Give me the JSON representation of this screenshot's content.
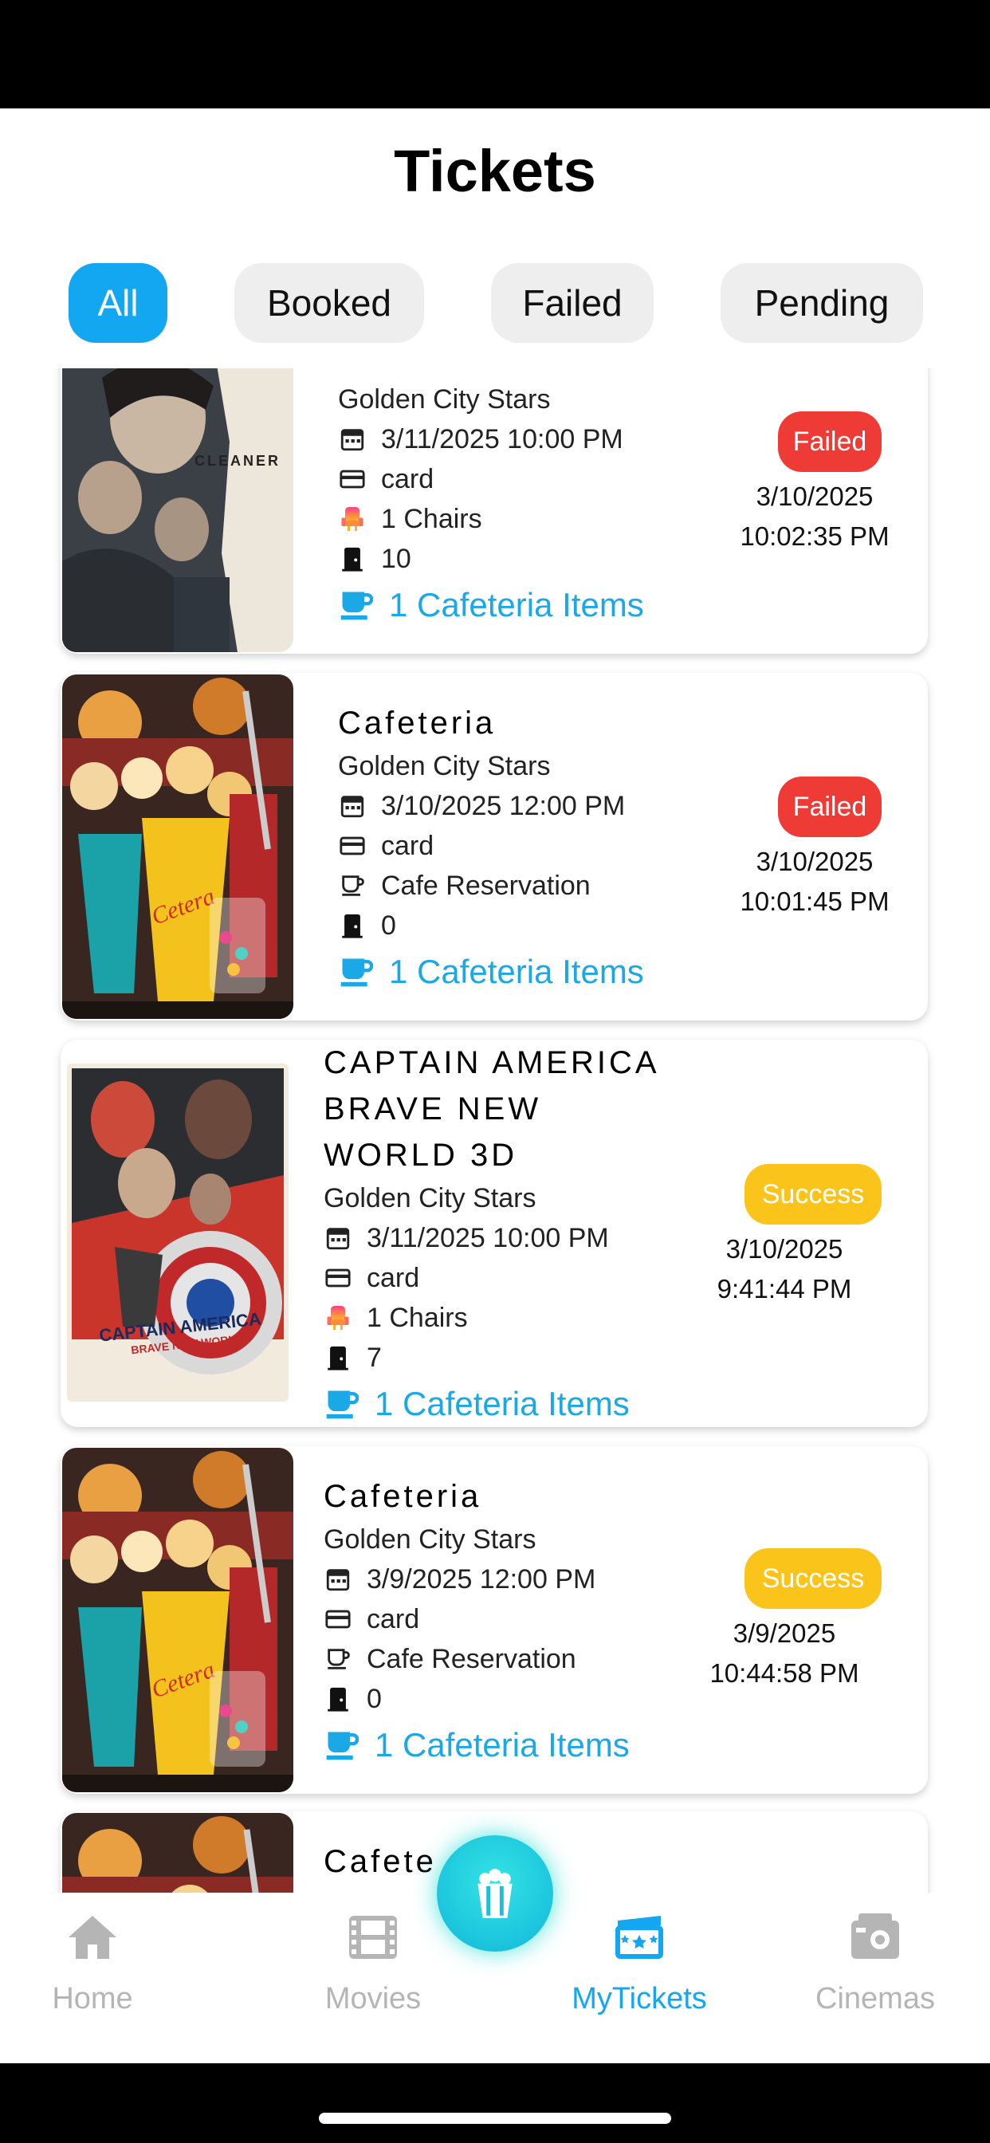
{
  "header": {
    "title": "Tickets"
  },
  "filters": [
    {
      "label": "All",
      "active": true
    },
    {
      "label": "Booked",
      "active": false
    },
    {
      "label": "Failed",
      "active": false
    },
    {
      "label": "Pending",
      "active": false
    }
  ],
  "tickets": [
    {
      "title": "",
      "poster_text": "CLEANER",
      "cinema": "Golden City Stars",
      "show_datetime": "3/11/2025 10:00 PM",
      "payment": "card",
      "seats": "1 Chairs",
      "hall": "10",
      "cafeteria": "1 Cafeteria Items",
      "status": "Failed",
      "booked_date": "3/10/2025",
      "booked_time": "10:02:35 PM"
    },
    {
      "title": "Cafeteria",
      "poster_text": "Cetera",
      "cinema": "Golden City Stars",
      "show_datetime": "3/10/2025 12:00 PM",
      "payment": "card",
      "seats": "Cafe Reservation",
      "hall": "0",
      "cafeteria": "1 Cafeteria Items",
      "status": "Failed",
      "booked_date": "3/10/2025",
      "booked_time": "10:01:45 PM"
    },
    {
      "title": "CAPTAIN AMERICA\nBRAVE NEW\nWORLD 3D",
      "poster_text": "CAPTAIN AMERICA",
      "poster_subtext": "BRAVE NEW WORLD",
      "cinema": "Golden City Stars",
      "show_datetime": "3/11/2025 10:00 PM",
      "payment": "card",
      "seats": "1 Chairs",
      "hall": "7",
      "cafeteria": "1 Cafeteria Items",
      "status": "Success",
      "booked_date": "3/10/2025",
      "booked_time": "9:41:44 PM"
    },
    {
      "title": "Cafeteria",
      "poster_text": "Cetera",
      "cinema": "Golden City Stars",
      "show_datetime": "3/9/2025 12:00 PM",
      "payment": "card",
      "seats": "Cafe Reservation",
      "hall": "0",
      "cafeteria": "1 Cafeteria Items",
      "status": "Success",
      "booked_date": "3/9/2025",
      "booked_time": "10:44:58 PM"
    },
    {
      "title": "Cafete"
    }
  ],
  "nav": {
    "items": [
      {
        "label": "Home",
        "icon": "home-icon"
      },
      {
        "label": "Movies",
        "icon": "film-icon"
      },
      {
        "label": "MyTickets",
        "icon": "ticket-icon"
      },
      {
        "label": "Cinemas",
        "icon": "cinema-icon"
      }
    ],
    "fab_icon": "popcorn-icon"
  },
  "colors": {
    "accent": "#12a7f0",
    "failed": "#ef3b36",
    "success": "#fbc41b",
    "cafeteria_link": "#1aa8e6",
    "fab": "#1fd0df"
  }
}
